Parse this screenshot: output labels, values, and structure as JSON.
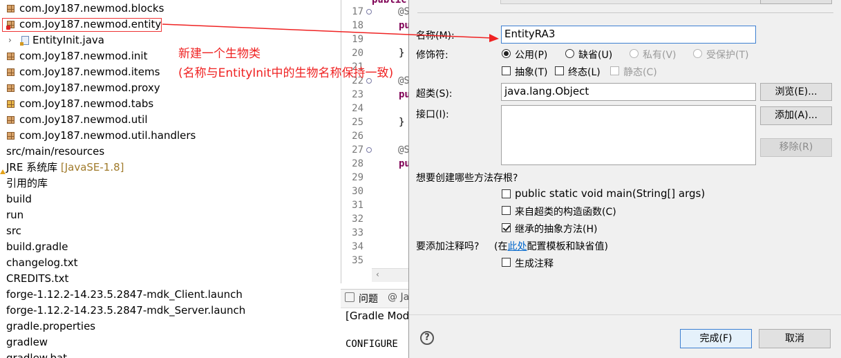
{
  "explorer": {
    "items": [
      {
        "label": "com.Joy187.newmod.blocks",
        "kind": "package"
      },
      {
        "label": "com.Joy187.newmod.entity",
        "kind": "package-error",
        "selected": true
      },
      {
        "label": "EntityInit.java",
        "kind": "java"
      },
      {
        "label": "com.Joy187.newmod.init",
        "kind": "package"
      },
      {
        "label": "com.Joy187.newmod.items",
        "kind": "package"
      },
      {
        "label": "com.Joy187.newmod.proxy",
        "kind": "package"
      },
      {
        "label": "com.Joy187.newmod.tabs",
        "kind": "package-warn"
      },
      {
        "label": "com.Joy187.newmod.util",
        "kind": "package"
      },
      {
        "label": "com.Joy187.newmod.util.handlers",
        "kind": "package"
      },
      {
        "label": "src/main/resources",
        "kind": "folder"
      },
      {
        "label": "JRE 系统库",
        "tag": "[JavaSE-1.8]",
        "kind": "library"
      },
      {
        "label": "引用的库",
        "kind": "folder"
      },
      {
        "label": "build",
        "kind": "folder"
      },
      {
        "label": "run",
        "kind": "folder"
      },
      {
        "label": "src",
        "kind": "folder"
      },
      {
        "label": "build.gradle",
        "kind": "file"
      },
      {
        "label": "changelog.txt",
        "kind": "file"
      },
      {
        "label": "CREDITS.txt",
        "kind": "file"
      },
      {
        "label": "forge-1.12.2-14.23.5.2847-mdk_Client.launch",
        "kind": "file"
      },
      {
        "label": "forge-1.12.2-14.23.5.2847-mdk_Server.launch",
        "kind": "file"
      },
      {
        "label": "gradle.properties",
        "kind": "file"
      },
      {
        "label": "gradlew",
        "kind": "file"
      },
      {
        "label": "gradlew.bat",
        "kind": "file"
      }
    ]
  },
  "annotation": {
    "line1": "新建一个生物类",
    "line2": "(名称与EntityInit中的生物名称保持一致)",
    "color": "#ef2222"
  },
  "editor": {
    "line_numbers": [
      "17",
      "18",
      "19",
      "20",
      "21",
      "22",
      "23",
      "24",
      "25",
      "26",
      "27",
      "28",
      "29",
      "30",
      "31",
      "32",
      "33",
      "34",
      "35"
    ],
    "code": [
      "@S",
      "pu",
      "",
      "}",
      "",
      "@S",
      "pu",
      "",
      "}",
      "",
      "@S",
      "pu",
      "",
      "",
      "",
      "",
      "",
      "",
      ""
    ],
    "top_partial": "public"
  },
  "console": {
    "tab_problems": "问题",
    "tab_java": "@ Ja",
    "gradle_line": "[Gradle Mod",
    "configure": "CONFIGURE"
  },
  "dialog": {
    "name_label": "名称(M):",
    "name_value": "EntityRA3",
    "modifiers_label": "修饰符:",
    "radio_public": "公用(P)",
    "radio_default": "缺省(U)",
    "radio_private": "私有(V)",
    "radio_protected": "受保护(T)",
    "check_abstract": "抽象(T)",
    "check_final": "终态(L)",
    "check_static": "静态(C)",
    "superclass_label": "超类(S):",
    "superclass_value": "java.lang.Object",
    "browse_button": "浏览(E)...",
    "interfaces_label": "接口(I):",
    "add_button": "添加(A)...",
    "remove_button": "移除(R)",
    "stubs_question": "想要创建哪些方法存根?",
    "stub_main": "public static void main(String[] args)",
    "stub_constructors": "来自超类的构造函数(C)",
    "stub_inherited": "继承的抽象方法(H)",
    "comments_question": "要添加注释吗?",
    "comments_hint_pre": "(在",
    "comments_hint_link": "此处",
    "comments_hint_post": "配置模板和缺省值)",
    "generate_comments": "生成注释",
    "finish_button": "完成(F)",
    "cancel_button": "取消",
    "help_icon": "?"
  }
}
